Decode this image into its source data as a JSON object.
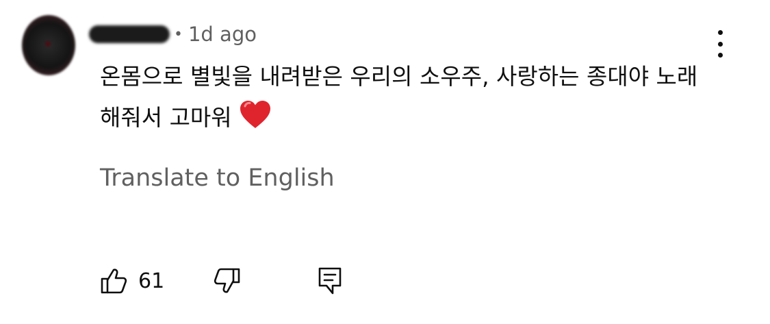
{
  "comment": {
    "author": "",
    "separator": "•",
    "time_ago": "1d ago",
    "text": "온몸으로 별빛을 내려받은 우리의 소우주, 사랑하는 종대야 노래해줘서 고마워",
    "emoji": "heart-emoji",
    "translate_label": "Translate to English",
    "like_count": "61"
  },
  "icons": {
    "more": "more-vertical-icon",
    "like": "thumbs-up-icon",
    "dislike": "thumbs-down-icon",
    "reply": "reply-comment-icon"
  },
  "colors": {
    "text": "#0f0f0f",
    "secondary": "#606060",
    "heart": "#e0242e",
    "background": "#ffffff"
  }
}
